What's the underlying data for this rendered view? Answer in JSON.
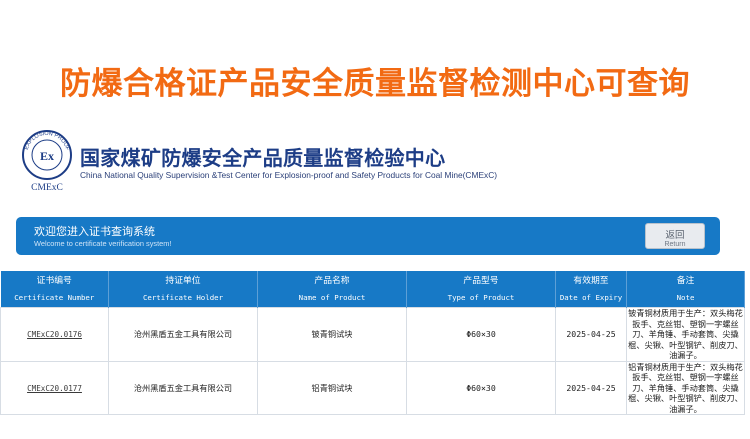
{
  "headline": "防爆合格证产品安全质量监督检测中心可查询",
  "logo": {
    "ring_text": "EXPLOSION PROOF",
    "mark": "Ex",
    "caption": "CMExC"
  },
  "organization": {
    "name_zh": "国家煤矿防爆安全产品质量监督检验中心",
    "name_en": "China National Quality Supervision &Test Center for Explosion-proof and Safety Products for Coal Mine(CMExC)"
  },
  "welcome": {
    "title": "欢迎您进入证书查询系统",
    "subtitle": "Welcome to certificate verification system!",
    "return_zh": "返回",
    "return_en": "Return"
  },
  "table": {
    "columns": [
      {
        "zh": "证书编号",
        "en": "Certificate Number"
      },
      {
        "zh": "持证单位",
        "en": "Certificate Holder"
      },
      {
        "zh": "产品名称",
        "en": "Name of Product"
      },
      {
        "zh": "产品型号",
        "en": "Type of Product"
      },
      {
        "zh": "有效期至",
        "en": "Date of Expiry"
      },
      {
        "zh": "备注",
        "en": "Note"
      }
    ],
    "rows": [
      {
        "cert": "CMExC20.0176",
        "holder": "沧州黑盾五金工具有限公司",
        "product": "铍青铜试块",
        "type": "Φ60×30",
        "expiry": "2025-04-25",
        "note": "铍青铜材质用于生产：双头梅花扳手、克丝钳、塑钢一字螺丝刀、羊角锤、手动套筒、尖撬棍、尖锹、叶型钢铲、削皮刀、油漏子。"
      },
      {
        "cert": "CMExC20.0177",
        "holder": "沧州黑盾五金工具有限公司",
        "product": "铝青铜试块",
        "type": "Φ60×30",
        "expiry": "2025-04-25",
        "note": "铝青铜材质用于生产：双头梅花扳手、克丝钳、塑钢一字螺丝刀、羊角锤、手动套筒、尖撬棍、尖锹、叶型钢铲、削皮刀、油漏子。"
      }
    ]
  },
  "colors": {
    "headline": "#f26a13",
    "brand_blue": "#1779c6",
    "org_title": "#1d3d86"
  }
}
